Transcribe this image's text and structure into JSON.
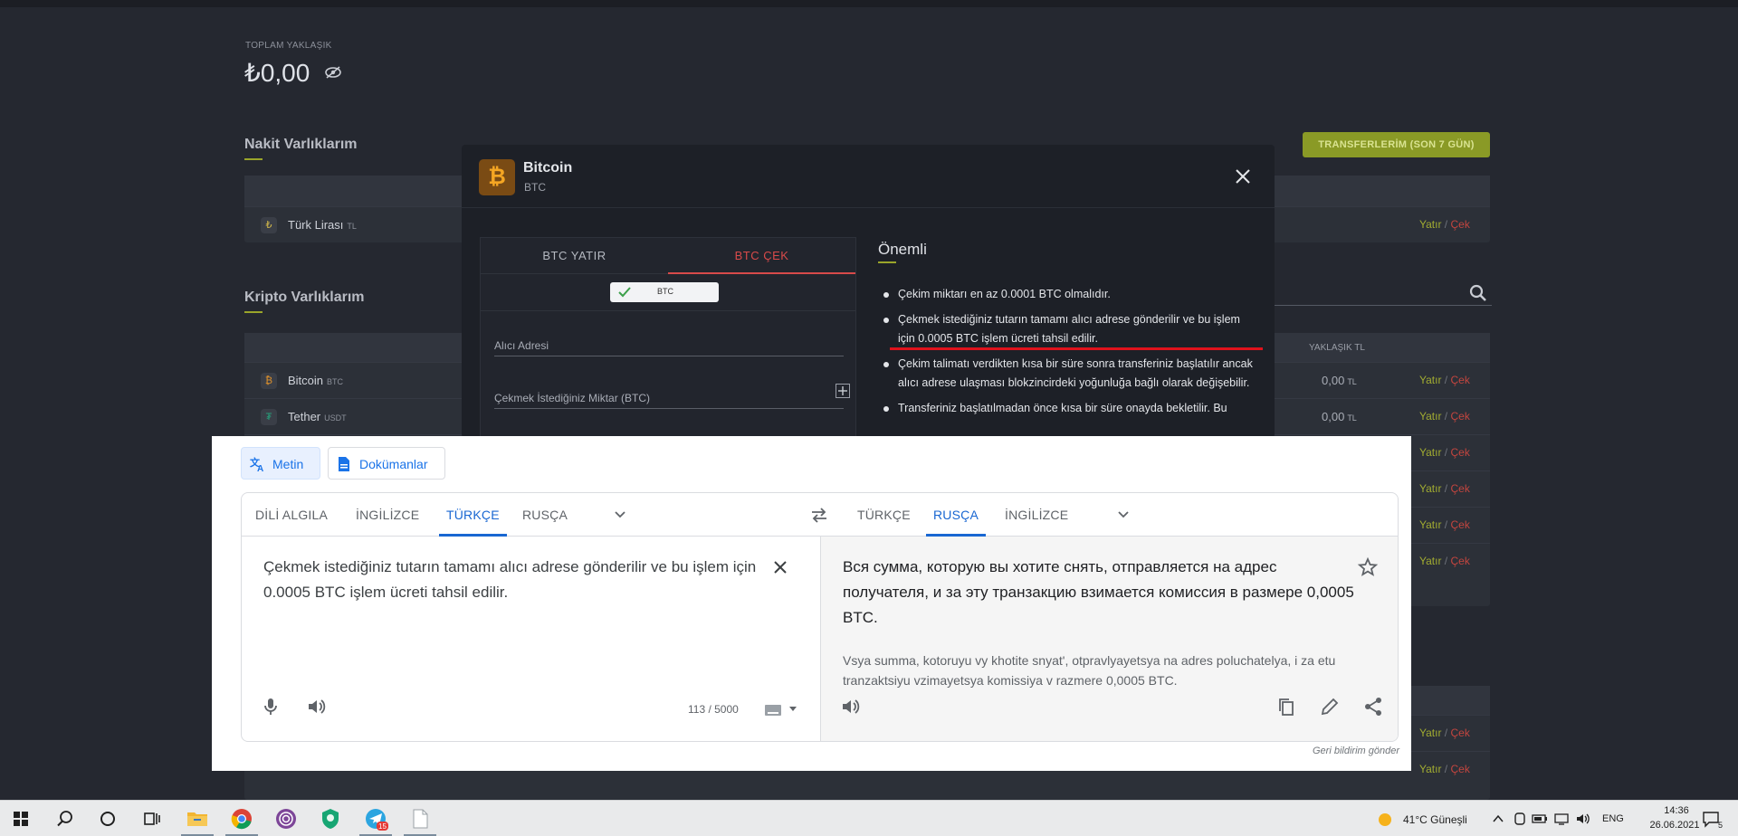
{
  "bg": {
    "total_label": "TOPLAM YAKLAŞIK",
    "total_value": "₺0,00",
    "cash_title": "Nakit Varlıklarım",
    "crypto_title": "Kripto Varlıklarım",
    "transfers_btn": "TRANSFERLERİM (SON 7 GÜN)",
    "approx_col": "YAKLAŞIK TL",
    "deposit_label": "Yatır",
    "sep": "/",
    "withdraw_label": "Çek",
    "lira": {
      "name": "Türk Lirası",
      "code": "TL"
    },
    "assets": [
      {
        "name": "Bitcoin",
        "code": "BTC",
        "amount": "0,00",
        "unit": "TL"
      },
      {
        "name": "Tether",
        "code": "USDT",
        "amount": "0,00",
        "unit": "TL"
      }
    ]
  },
  "modal": {
    "title": "Bitcoin",
    "subtitle": "BTC",
    "tab_deposit": "BTC YATIR",
    "tab_withdraw": "BTC ÇEK",
    "network_chip": "BTC",
    "address_label": "Alıcı Adresi",
    "amount_label": "Çekmek İstediğiniz Miktar (BTC)",
    "info_title": "Önemli",
    "info_items": [
      "Çekim miktarı en az 0.0001 BTC olmalıdır.",
      "Çekmek istediğiniz tutarın tamamı alıcı adrese gönderilir ve bu işlem için 0.0005 BTC işlem ücreti tahsil edilir.",
      "Çekim talimatı verdikten kısa bir süre sonra transferiniz başlatılır ancak alıcı adrese ulaşması blokzincirdeki yoğunluğa bağlı olarak değişebilir.",
      "Transferiniz başlatılmadan önce kısa bir süre onayda bekletilir. Bu"
    ]
  },
  "translate": {
    "mode_text": "Metin",
    "mode_docs": "Dokümanlar",
    "src_langs": [
      "DİLİ ALGILA",
      "İNGİLİZCE",
      "TÜRKÇE",
      "RUSÇA"
    ],
    "tgt_langs": [
      "TÜRKÇE",
      "RUSÇA",
      "İNGİLİZCE"
    ],
    "source_text": "Çekmek istediğiniz tutarın tamamı alıcı adrese gönderilir ve bu işlem için 0.0005 BTC işlem ücreti tahsil edilir.",
    "target_text": "Вся сумма, которую вы хотите снять, отправляется на адрес получателя, и за эту транзакцию взимается комиссия в размере 0,0005 BTC.",
    "transliteration": "Vsya summa, kotoruyu vy khotite snyat', otpravlyayetsya na adres poluchatelya, i za etu tranzaktsiyu vzimayetsya komissiya v razmere 0,0005 BTC.",
    "char_count": "113 / 5000",
    "feedback": "Geri bildirim gönder"
  },
  "taskbar": {
    "weather": "41°C  Güneşli",
    "lang": "ENG",
    "time": "14:36",
    "date": "26.06.2021",
    "notif_count": "5",
    "telegram_badge": "15"
  },
  "colors": {
    "accent_green": "#9aa52a",
    "withdraw_red": "#d84a4a",
    "google_blue": "#1967d2"
  }
}
